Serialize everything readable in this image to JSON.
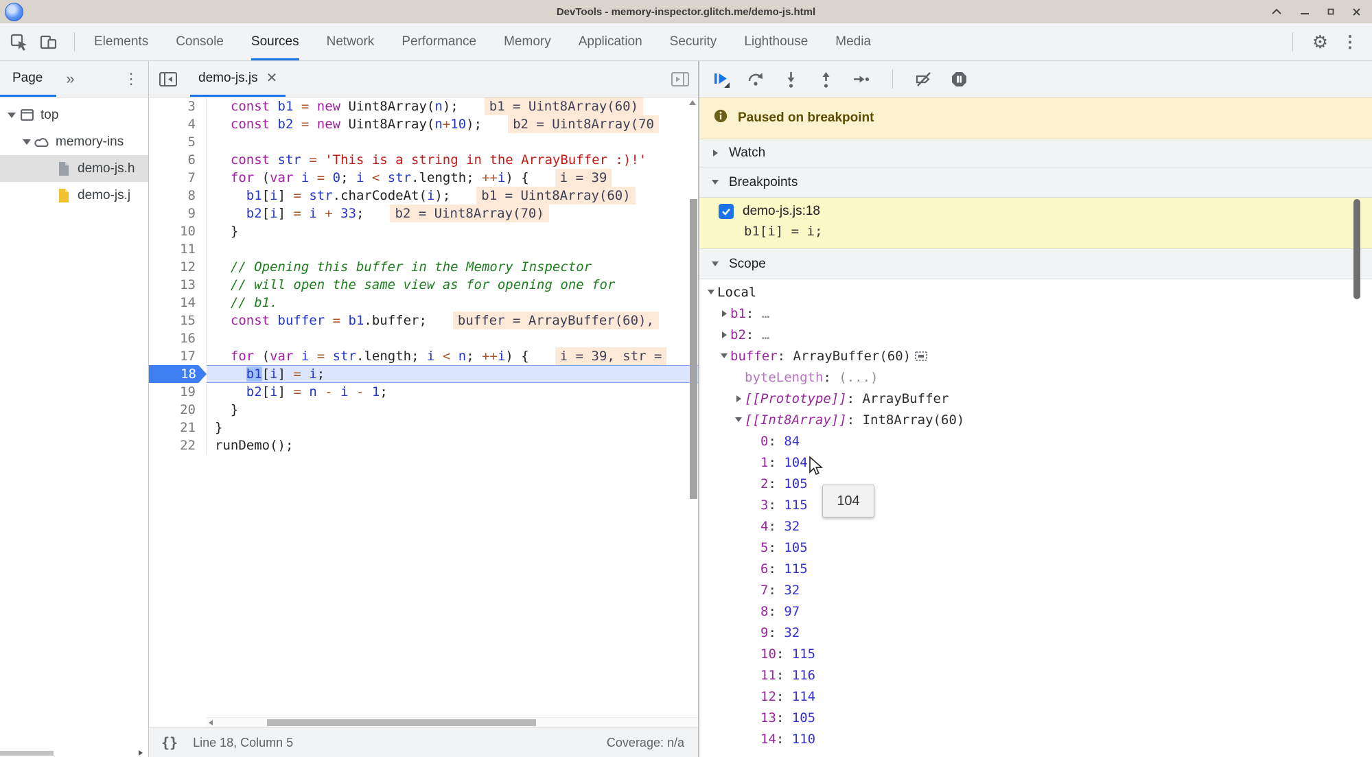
{
  "window": {
    "title": "DevTools - memory-inspector.glitch.me/demo-js.html"
  },
  "toolbar": {
    "tabs": [
      "Elements",
      "Console",
      "Sources",
      "Network",
      "Performance",
      "Memory",
      "Application",
      "Security",
      "Lighthouse",
      "Media"
    ],
    "active_tab": "Sources"
  },
  "sidebar": {
    "tab_label": "Page",
    "tree": [
      {
        "label": "top",
        "icon": "frame",
        "depth": 0,
        "arrow": "down",
        "selected": false
      },
      {
        "label": "memory-ins",
        "icon": "cloud",
        "depth": 1,
        "arrow": "down",
        "selected": false
      },
      {
        "label": "demo-js.h",
        "icon": "page_gray",
        "depth": 2,
        "arrow": "none",
        "selected": true
      },
      {
        "label": "demo-js.j",
        "icon": "page_yellow",
        "depth": 2,
        "arrow": "none",
        "selected": false
      }
    ]
  },
  "editor": {
    "tab_label": "demo-js.js",
    "status": {
      "pretty_print": "{}",
      "line_col": "Line 18, Column 5",
      "coverage": "Coverage: n/a"
    },
    "lines": [
      {
        "n": 3,
        "tokens": [
          [
            "p",
            "  "
          ],
          [
            "k",
            "const"
          ],
          [
            "p",
            " "
          ],
          [
            "v",
            "b1"
          ],
          [
            "o",
            " = "
          ],
          [
            "k",
            "new"
          ],
          [
            "p",
            " Uint8Array("
          ],
          [
            "v",
            "n"
          ],
          [
            "p",
            ");"
          ]
        ],
        "hint": "b1 = Uint8Array(60)"
      },
      {
        "n": 4,
        "tokens": [
          [
            "p",
            "  "
          ],
          [
            "k",
            "const"
          ],
          [
            "p",
            " "
          ],
          [
            "v",
            "b2"
          ],
          [
            "o",
            " = "
          ],
          [
            "k",
            "new"
          ],
          [
            "p",
            " Uint8Array("
          ],
          [
            "v",
            "n"
          ],
          [
            "o",
            "+"
          ],
          [
            "n",
            "10"
          ],
          [
            "p",
            ");"
          ]
        ],
        "hint": "b2 = Uint8Array(70"
      },
      {
        "n": 5,
        "tokens": []
      },
      {
        "n": 6,
        "tokens": [
          [
            "p",
            "  "
          ],
          [
            "k",
            "const"
          ],
          [
            "p",
            " "
          ],
          [
            "v",
            "str"
          ],
          [
            "o",
            " = "
          ],
          [
            "s",
            "'This is a string in the ArrayBuffer :)!'"
          ]
        ]
      },
      {
        "n": 7,
        "tokens": [
          [
            "p",
            "  "
          ],
          [
            "k",
            "for"
          ],
          [
            "p",
            " ("
          ],
          [
            "k",
            "var"
          ],
          [
            "p",
            " "
          ],
          [
            "v",
            "i"
          ],
          [
            "o",
            " = "
          ],
          [
            "n",
            "0"
          ],
          [
            "p",
            "; "
          ],
          [
            "v",
            "i"
          ],
          [
            "o",
            " < "
          ],
          [
            "v",
            "str"
          ],
          [
            "p",
            ".length; "
          ],
          [
            "o",
            "++"
          ],
          [
            "v",
            "i"
          ],
          [
            "p",
            ") {"
          ]
        ],
        "hint": "i = 39"
      },
      {
        "n": 8,
        "tokens": [
          [
            "p",
            "    "
          ],
          [
            "v",
            "b1"
          ],
          [
            "p",
            "["
          ],
          [
            "v",
            "i"
          ],
          [
            "p",
            "] "
          ],
          [
            "o",
            "= "
          ],
          [
            "v",
            "str"
          ],
          [
            "p",
            ".charCodeAt("
          ],
          [
            "v",
            "i"
          ],
          [
            "p",
            ");"
          ]
        ],
        "hint": "b1 = Uint8Array(60)"
      },
      {
        "n": 9,
        "tokens": [
          [
            "p",
            "    "
          ],
          [
            "v",
            "b2"
          ],
          [
            "p",
            "["
          ],
          [
            "v",
            "i"
          ],
          [
            "p",
            "] "
          ],
          [
            "o",
            "= "
          ],
          [
            "v",
            "i"
          ],
          [
            "o",
            " + "
          ],
          [
            "n",
            "33"
          ],
          [
            "p",
            ";"
          ]
        ],
        "hint": "b2 = Uint8Array(70)"
      },
      {
        "n": 10,
        "tokens": [
          [
            "p",
            "  }"
          ]
        ]
      },
      {
        "n": 11,
        "tokens": []
      },
      {
        "n": 12,
        "tokens": [
          [
            "p",
            "  "
          ],
          [
            "c",
            "// Opening this buffer in the Memory Inspector"
          ]
        ]
      },
      {
        "n": 13,
        "tokens": [
          [
            "p",
            "  "
          ],
          [
            "c",
            "// will open the same view as for opening one for"
          ]
        ]
      },
      {
        "n": 14,
        "tokens": [
          [
            "p",
            "  "
          ],
          [
            "c",
            "// b1."
          ]
        ]
      },
      {
        "n": 15,
        "tokens": [
          [
            "p",
            "  "
          ],
          [
            "k",
            "const"
          ],
          [
            "p",
            " "
          ],
          [
            "v",
            "buffer"
          ],
          [
            "o",
            " = "
          ],
          [
            "v",
            "b1"
          ],
          [
            "p",
            ".buffer;"
          ]
        ],
        "hint": "buffer = ArrayBuffer(60),"
      },
      {
        "n": 16,
        "tokens": []
      },
      {
        "n": 17,
        "tokens": [
          [
            "p",
            "  "
          ],
          [
            "k",
            "for"
          ],
          [
            "p",
            " ("
          ],
          [
            "k",
            "var"
          ],
          [
            "p",
            " "
          ],
          [
            "v",
            "i"
          ],
          [
            "o",
            " = "
          ],
          [
            "v",
            "str"
          ],
          [
            "p",
            ".length; "
          ],
          [
            "v",
            "i"
          ],
          [
            "o",
            " < "
          ],
          [
            "v",
            "n"
          ],
          [
            "p",
            "; "
          ],
          [
            "o",
            "++"
          ],
          [
            "v",
            "i"
          ],
          [
            "p",
            ") {"
          ]
        ],
        "hint": "i = 39, str ="
      },
      {
        "n": 18,
        "current": true,
        "tokens": [
          [
            "p",
            "    "
          ],
          [
            "h",
            "b1"
          ],
          [
            "p",
            "["
          ],
          [
            "v",
            "i"
          ],
          [
            "p",
            "] "
          ],
          [
            "o",
            "= "
          ],
          [
            "v",
            "i"
          ],
          [
            "p",
            ";"
          ]
        ]
      },
      {
        "n": 19,
        "tokens": [
          [
            "p",
            "    "
          ],
          [
            "v",
            "b2"
          ],
          [
            "p",
            "["
          ],
          [
            "v",
            "i"
          ],
          [
            "p",
            "] "
          ],
          [
            "o",
            "= "
          ],
          [
            "v",
            "n"
          ],
          [
            "o",
            " - "
          ],
          [
            "v",
            "i"
          ],
          [
            "o",
            " - "
          ],
          [
            "n",
            "1"
          ],
          [
            "p",
            ";"
          ]
        ]
      },
      {
        "n": 20,
        "tokens": [
          [
            "p",
            "  }"
          ]
        ]
      },
      {
        "n": 21,
        "tokens": [
          [
            "p",
            "}"
          ]
        ]
      },
      {
        "n": 22,
        "tokens": [
          [
            "p",
            "runDemo();"
          ]
        ]
      }
    ]
  },
  "debugger": {
    "paused_message": "Paused on breakpoint",
    "watch_label": "Watch",
    "breakpoints_label": "Breakpoints",
    "scope_label": "Scope",
    "breakpoint": {
      "location": "demo-js.js:18",
      "code": "b1[i] = i;",
      "checked": true
    },
    "scope": {
      "rows": [
        {
          "d": 0,
          "arrow": "down",
          "name": "Local",
          "plain": true
        },
        {
          "d": 1,
          "arrow": "right",
          "name": "b1",
          "value": "…",
          "vs": "muted"
        },
        {
          "d": 1,
          "arrow": "right",
          "name": "b2",
          "value": "…",
          "vs": "muted"
        },
        {
          "d": 1,
          "arrow": "down",
          "name": "buffer",
          "value": "ArrayBuffer(60)",
          "vs": "plain",
          "mem": true
        },
        {
          "d": 2,
          "arrow": "none",
          "name": "byteLength",
          "ns": "dim",
          "value": "(...)",
          "vs": "muted"
        },
        {
          "d": 2,
          "arrow": "right",
          "name": "[[Prototype]]",
          "ns": "br",
          "value": "ArrayBuffer",
          "vs": "plain"
        },
        {
          "d": 2,
          "arrow": "down",
          "name": "[[Int8Array]]",
          "ns": "br",
          "value": "Int8Array(60)",
          "vs": "plain"
        }
      ],
      "int8_entries": [
        [
          0,
          84
        ],
        [
          1,
          104
        ],
        [
          2,
          105
        ],
        [
          3,
          115
        ],
        [
          4,
          32
        ],
        [
          5,
          105
        ],
        [
          6,
          115
        ],
        [
          7,
          32
        ],
        [
          8,
          97
        ],
        [
          9,
          32
        ],
        [
          10,
          115
        ],
        [
          11,
          116
        ],
        [
          12,
          114
        ],
        [
          13,
          105
        ],
        [
          14,
          110
        ]
      ]
    },
    "tooltip": "104",
    "accent_color": "#1a73e8",
    "paused_bg": "#fbf2cf",
    "breakpoint_bg": "#fbf9c7"
  }
}
